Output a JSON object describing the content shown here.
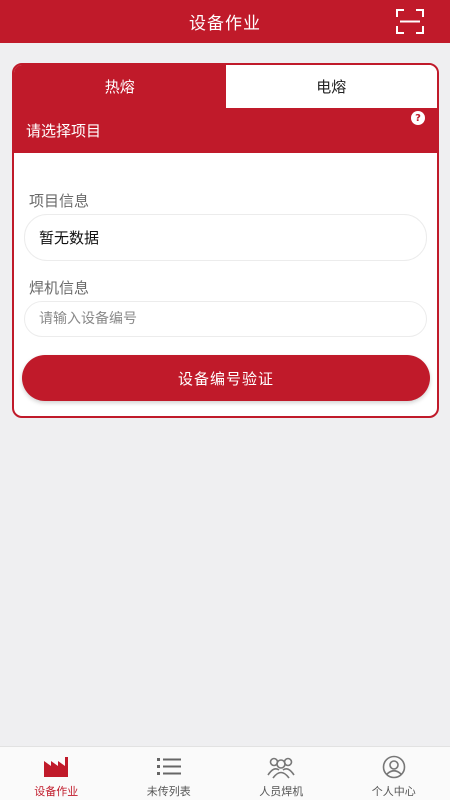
{
  "header": {
    "title": "设备作业",
    "scan_icon": "scan-icon"
  },
  "tabs": [
    {
      "label": "热熔",
      "active": true
    },
    {
      "label": "电熔",
      "active": false
    }
  ],
  "project": {
    "select_label": "请选择项目",
    "help_icon": "help-icon",
    "help_glyph": "?"
  },
  "project_info": {
    "label": "项目信息",
    "value": "暂无数据"
  },
  "welder_info": {
    "label": "焊机信息",
    "placeholder": "请输入设备编号",
    "value": ""
  },
  "verify_button": {
    "label": "设备编号验证"
  },
  "nav": [
    {
      "label": "设备作业",
      "icon": "factory-icon",
      "active": true
    },
    {
      "label": "未传列表",
      "icon": "list-icon",
      "active": false
    },
    {
      "label": "人员焊机",
      "icon": "people-icon",
      "active": false
    },
    {
      "label": "个人中心",
      "icon": "person-icon",
      "active": false
    }
  ],
  "colors": {
    "accent": "#c01a2a",
    "background": "#efeff1"
  }
}
